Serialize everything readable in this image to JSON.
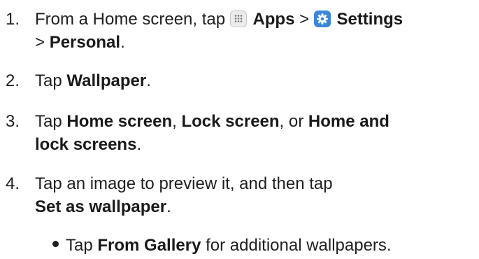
{
  "steps": [
    {
      "number": "1.",
      "parts": {
        "prefix": "From a Home screen, tap ",
        "apps": "Apps",
        "sep1": " > ",
        "settings": "Settings",
        "line2_sep": "> ",
        "personal": "Personal",
        "end": "."
      },
      "icons": [
        "apps-grid-icon",
        "settings-gear-icon"
      ]
    },
    {
      "number": "2.",
      "parts": {
        "prefix": "Tap ",
        "wallpaper": "Wallpaper",
        "end": "."
      }
    },
    {
      "number": "3.",
      "parts": {
        "prefix": "Tap ",
        "home_screen": "Home screen",
        "comma1": ", ",
        "lock_screen": "Lock screen",
        "or": ", or ",
        "home_and": "Home and",
        "lock_screens": "lock screens",
        "end": "."
      }
    },
    {
      "number": "4.",
      "parts": {
        "line1": "Tap an image to preview it, and then tap",
        "set_as_wallpaper": "Set as wallpaper",
        "end": "."
      }
    }
  ],
  "bullet": {
    "prefix": "Tap ",
    "from_gallery": "From Gallery",
    "suffix": " for additional wallpapers."
  },
  "colors": {
    "settings_icon_bg": "#3a86d9",
    "apps_icon_bg": "#ececec"
  }
}
